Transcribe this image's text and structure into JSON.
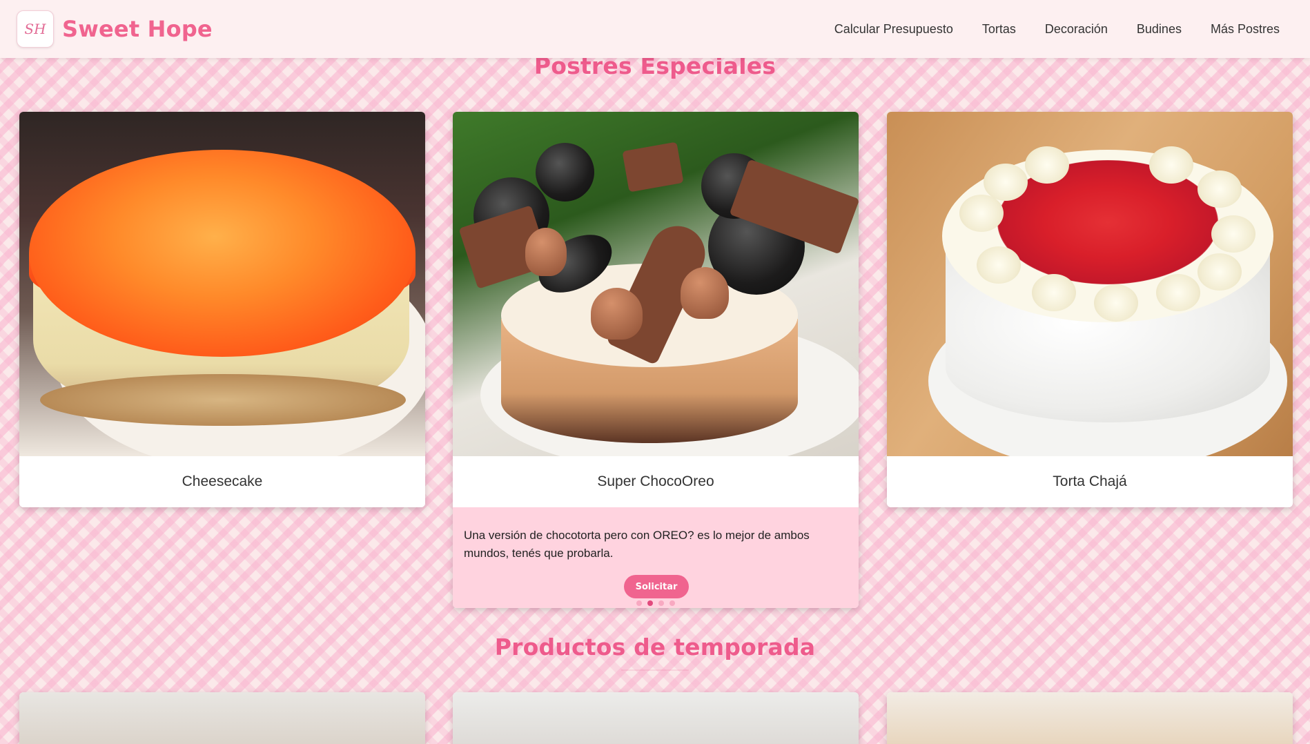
{
  "nav": {
    "brand": "Sweet Hope",
    "logo_text": "SH",
    "links": [
      "Calcular Presupuesto",
      "Tortas",
      "Decoración",
      "Budines",
      "Más Postres"
    ]
  },
  "sections": {
    "especiales": {
      "title": "Postres Especiales",
      "cards": [
        {
          "title": "Cheesecake"
        },
        {
          "title": "Super ChocoOreo",
          "description": "Una versión de chocotorta pero con OREO? es lo mejor de ambos mundos, tenés que probarla.",
          "button": "Solicitar"
        },
        {
          "title": "Torta Chajá"
        }
      ],
      "carousel": {
        "count": 4,
        "active": 2
      }
    },
    "temporada": {
      "title": "Productos de temporada"
    }
  },
  "colors": {
    "accent": "#f0648f",
    "title": "#ee5b8c",
    "desc_bg": "#ffd3df",
    "navbar_bg": "#fdf0f1"
  }
}
